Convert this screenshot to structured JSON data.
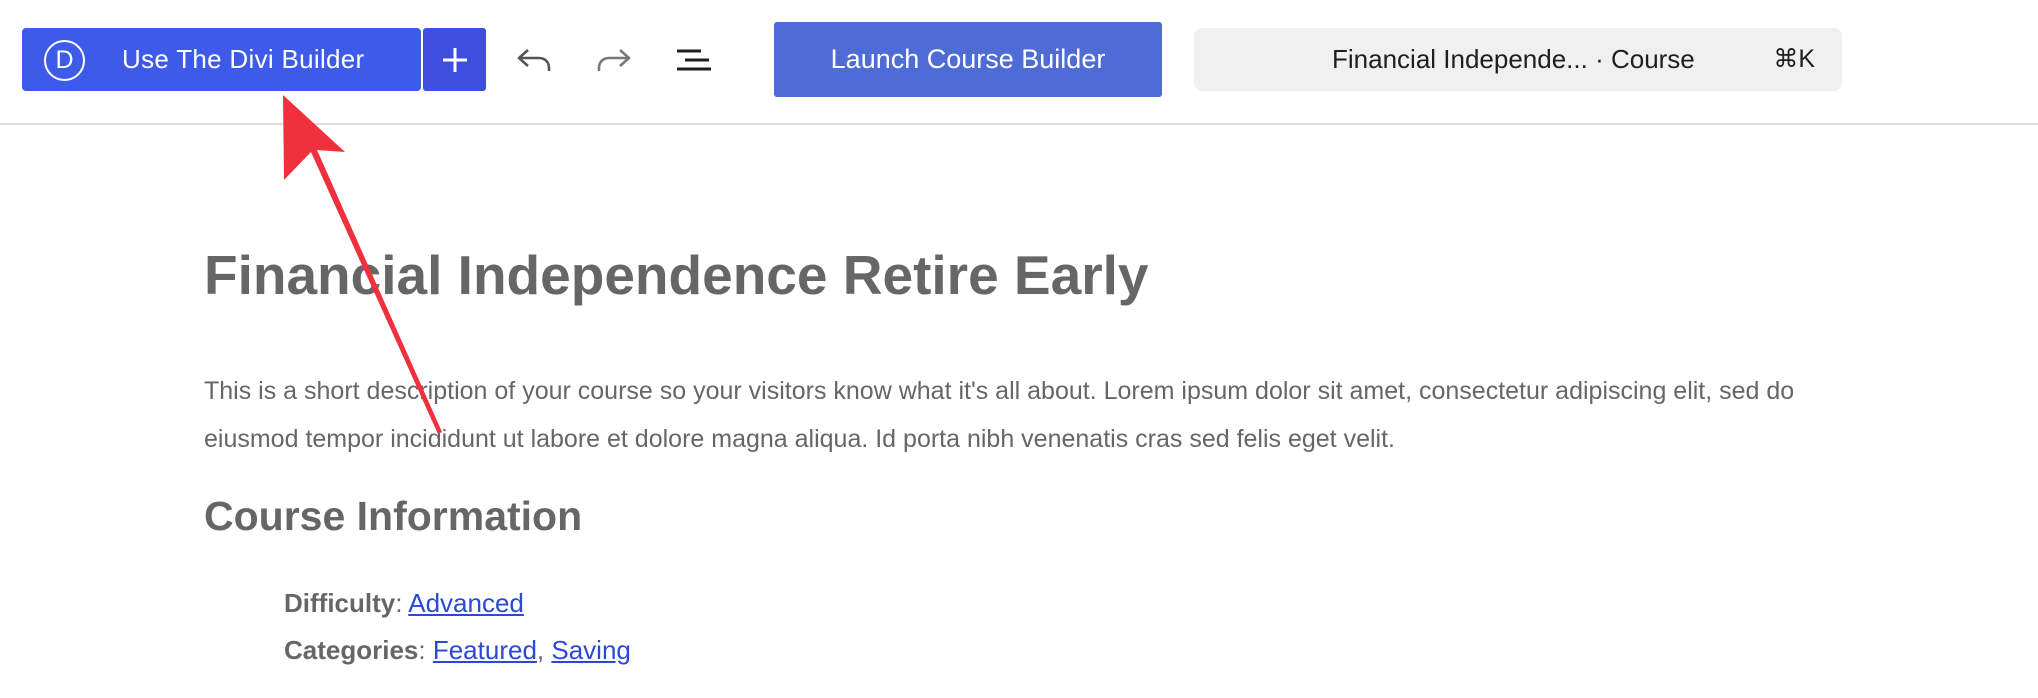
{
  "toolbar": {
    "divi_logo_letter": "D",
    "divi_button_label": "Use The Divi Builder",
    "add_icon": "plus-icon",
    "undo_icon": "undo-icon",
    "redo_icon": "redo-icon",
    "layers_icon": "list-view-icon",
    "launch_button_label": "Launch Course Builder",
    "command_bar": {
      "title": "Financial Independe... · Course",
      "shortcut": "⌘K"
    }
  },
  "content": {
    "title": "Financial Independence Retire Early",
    "description": "This is a short description of your course so your visitors know what it's all about. Lorem ipsum dolor sit amet, consectetur adipiscing elit, sed do eiusmod tempor incididunt ut labore et dolore magna aliqua. Id porta nibh venenatis cras sed felis eget velit.",
    "section_title": "Course Information",
    "difficulty": {
      "label": "Difficulty",
      "value": "Advanced"
    },
    "categories": {
      "label": "Categories",
      "items": [
        "Featured",
        "Saving"
      ]
    }
  },
  "colors": {
    "divi_button": "#3e5ae8",
    "add_button": "#3e4fe0",
    "launch_button": "#4f6bd6",
    "link": "#2b49d9",
    "text": "#666666",
    "annotation_arrow": "#f0303d"
  }
}
